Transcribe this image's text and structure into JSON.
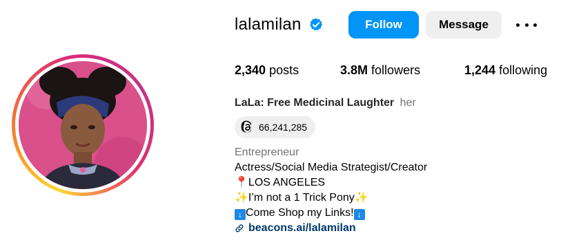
{
  "profile": {
    "username": "lalamilan",
    "follow_label": "Follow",
    "message_label": "Message",
    "stats": {
      "posts_count": "2,340",
      "posts_label": "posts",
      "followers_count": "3.8M",
      "followers_label": "followers",
      "following_count": "1,244",
      "following_label": "following"
    },
    "full_name": "LaLa: Free Medicinal Laughter",
    "pronouns": "her",
    "threads_count": "66,241,285",
    "category": "Entrepreneur",
    "bio_line1": "Actress/Social Media Strategist/Creator",
    "bio_line2": "LOS ANGELES",
    "bio_line3": "I’m not a 1 Trick Pony",
    "bio_line4": "Come Shop my Links!",
    "link": "beacons.ai/lalamilan"
  },
  "colors": {
    "follow_button": "#0095f6",
    "message_button": "#efefef",
    "link": "#00376b",
    "muted_text": "#737373"
  },
  "icons": [
    "verified-badge-icon",
    "more-options-icon",
    "threads-icon",
    "link-icon",
    "pin-emoji",
    "sparkles-emoji",
    "down-arrow-emoji"
  ]
}
